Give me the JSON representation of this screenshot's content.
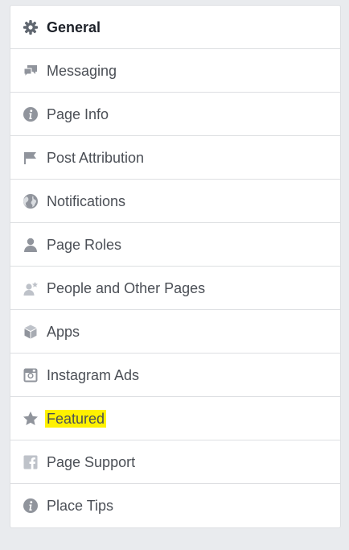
{
  "settings_menu": {
    "highlight_color": "#fff100",
    "items": [
      {
        "label": "General",
        "icon": "gear-icon",
        "active": true
      },
      {
        "label": "Messaging",
        "icon": "messaging-icon"
      },
      {
        "label": "Page Info",
        "icon": "info-icon"
      },
      {
        "label": "Post Attribution",
        "icon": "flag-icon"
      },
      {
        "label": "Notifications",
        "icon": "globe-icon"
      },
      {
        "label": "Page Roles",
        "icon": "person-icon"
      },
      {
        "label": "People and Other Pages",
        "icon": "person-star-icon"
      },
      {
        "label": "Apps",
        "icon": "cube-icon"
      },
      {
        "label": "Instagram Ads",
        "icon": "instagram-icon"
      },
      {
        "label": "Featured",
        "icon": "star-icon",
        "highlighted": true
      },
      {
        "label": "Page Support",
        "icon": "facebook-icon"
      },
      {
        "label": "Place Tips",
        "icon": "info-icon"
      }
    ]
  }
}
